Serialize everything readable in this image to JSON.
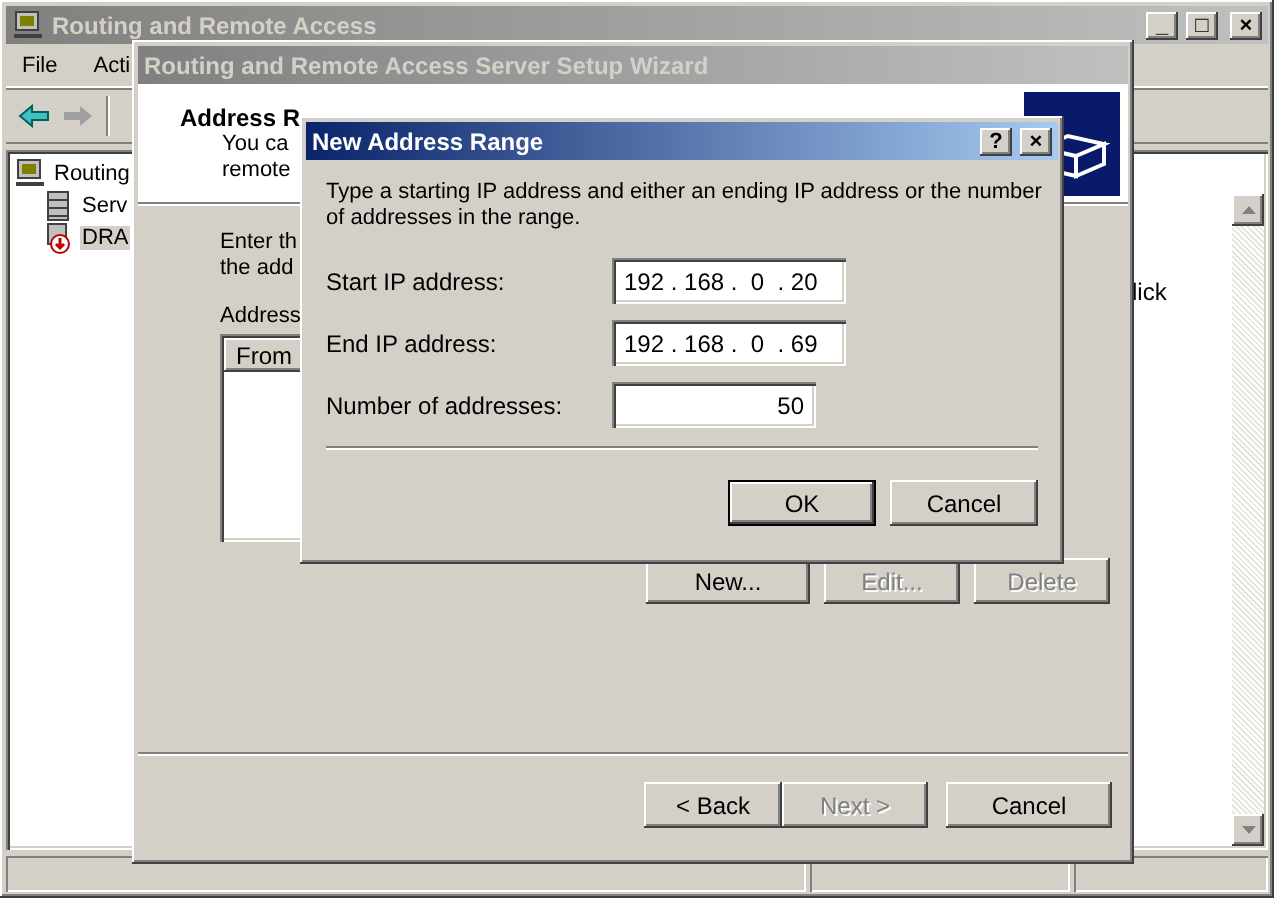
{
  "main_window": {
    "title": "Routing and Remote Access",
    "window_buttons": [
      "_",
      "□",
      "×"
    ],
    "menu": [
      "File",
      "Acti"
    ],
    "tree": [
      {
        "label": "Routing",
        "selected": false,
        "children": [
          {
            "label": "Serv",
            "selected": false,
            "kind": "servers"
          },
          {
            "label": "DRA",
            "selected": true,
            "kind": "server"
          }
        ]
      }
    ],
    "right_pane": {
      "text": "lick"
    }
  },
  "wizard": {
    "title": "Routing and Remote Access Server Setup Wizard",
    "header_title": "Address R",
    "header_lines": [
      "You ca",
      "remote"
    ],
    "intro_lines": [
      "Enter th",
      "the add"
    ],
    "list_label": "Address",
    "list_columns": [
      "From"
    ],
    "list_buttons": [
      {
        "label": "New...",
        "disabled": false
      },
      {
        "label": "Edit...",
        "disabled": true
      },
      {
        "label": "Delete",
        "disabled": true
      }
    ],
    "nav_buttons": [
      {
        "label": "< Back",
        "disabled": false
      },
      {
        "label": "Next >",
        "disabled": true
      },
      {
        "label": "Cancel",
        "disabled": false
      }
    ]
  },
  "dialog": {
    "title": "New Address Range",
    "title_buttons": [
      "?",
      "×"
    ],
    "description": "Type a starting IP address and either an ending IP address or the number of addresses in the range.",
    "fields": [
      {
        "kind": "ip",
        "label": "Start IP address:",
        "value": "192 . 168 .  0  . 20"
      },
      {
        "kind": "ip",
        "label": "End IP address:",
        "value": "192 . 168 .  0  . 69"
      },
      {
        "kind": "number",
        "label": "Number of addresses:",
        "value": "50"
      }
    ],
    "buttons": [
      {
        "label": "OK",
        "default": true
      },
      {
        "label": "Cancel",
        "default": false
      }
    ]
  }
}
